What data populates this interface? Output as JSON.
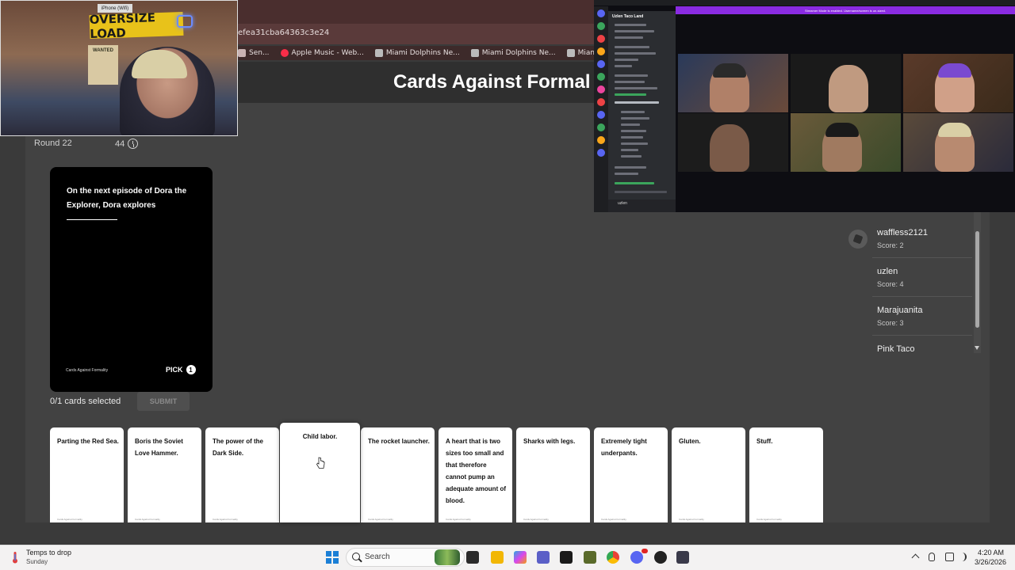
{
  "browser": {
    "url_fragment": "efea31cba64363c3e24",
    "bookmarks": [
      {
        "label": "Sen...",
        "icon": "bookmark-icon"
      },
      {
        "label": "Apple Music - Web...",
        "icon": "apple-music-icon"
      },
      {
        "label": "Miami Dolphins Ne...",
        "icon": "dolphins-icon"
      },
      {
        "label": "Miami Dolphins Ne...",
        "icon": "dolphins-icon"
      },
      {
        "label": "Miami Dolphins Ne...",
        "icon": "dolphins-icon"
      }
    ]
  },
  "app": {
    "title": "Cards Against Formal"
  },
  "game": {
    "round": "Round 22",
    "timer": "44",
    "black_card": {
      "text": "On the next episode of Dora the Explorer, Dora explores",
      "brand": "Cards Against Formality",
      "pick_label": "PICK",
      "pick_count": "1"
    },
    "selected_count": "0/1 cards selected",
    "submit_label": "SUBMIT",
    "hand": [
      {
        "text": "Parting the Red Sea.",
        "brand": "Cards Against Formality"
      },
      {
        "text": "Boris the Soviet Love Hammer.",
        "brand": "Cards Against Formality"
      },
      {
        "text": "The power of the Dark Side.",
        "brand": "Cards Against Formality"
      },
      {
        "text": "Child labor.",
        "brand": "",
        "hovered": true
      },
      {
        "text": "The rocket launcher.",
        "brand": "Cards Against Formality"
      },
      {
        "text": "A heart that is two sizes too small and that therefore cannot pump an adequate amount of blood.",
        "brand": "Cards Against Formality"
      },
      {
        "text": "Sharks with legs.",
        "brand": "Cards Against Formality"
      },
      {
        "text": "Extremely tight underpants.",
        "brand": "Cards Against Formality"
      },
      {
        "text": "Gluten.",
        "brand": "Cards Against Formality"
      },
      {
        "text": "Stuff.",
        "brand": "Cards Against Formality"
      }
    ]
  },
  "players": [
    {
      "name": "waffless2121",
      "score": "Score: 2",
      "czar": true
    },
    {
      "name": "uzlen",
      "score": "Score: 4"
    },
    {
      "name": "Marajuanita",
      "score": "Score: 3"
    },
    {
      "name": "Pink Taco",
      "score": ""
    }
  ],
  "webcam": {
    "sign_text": "OVERSIZE LOAD",
    "top_sign": "iPhone (Wifi)",
    "poster_text": "WANTED"
  },
  "discord": {
    "server_name": "Uzlen Taco Land",
    "banner": "Streamer Mode is enabled. Username/screen is un-sized.",
    "user_name": "uzlen",
    "accent": "#8a2be2"
  },
  "taskbar": {
    "weather_title": "Temps to drop",
    "weather_sub": "Sunday",
    "search_label": "Search",
    "time": "4:20 AM",
    "date": "3/26/2026"
  }
}
